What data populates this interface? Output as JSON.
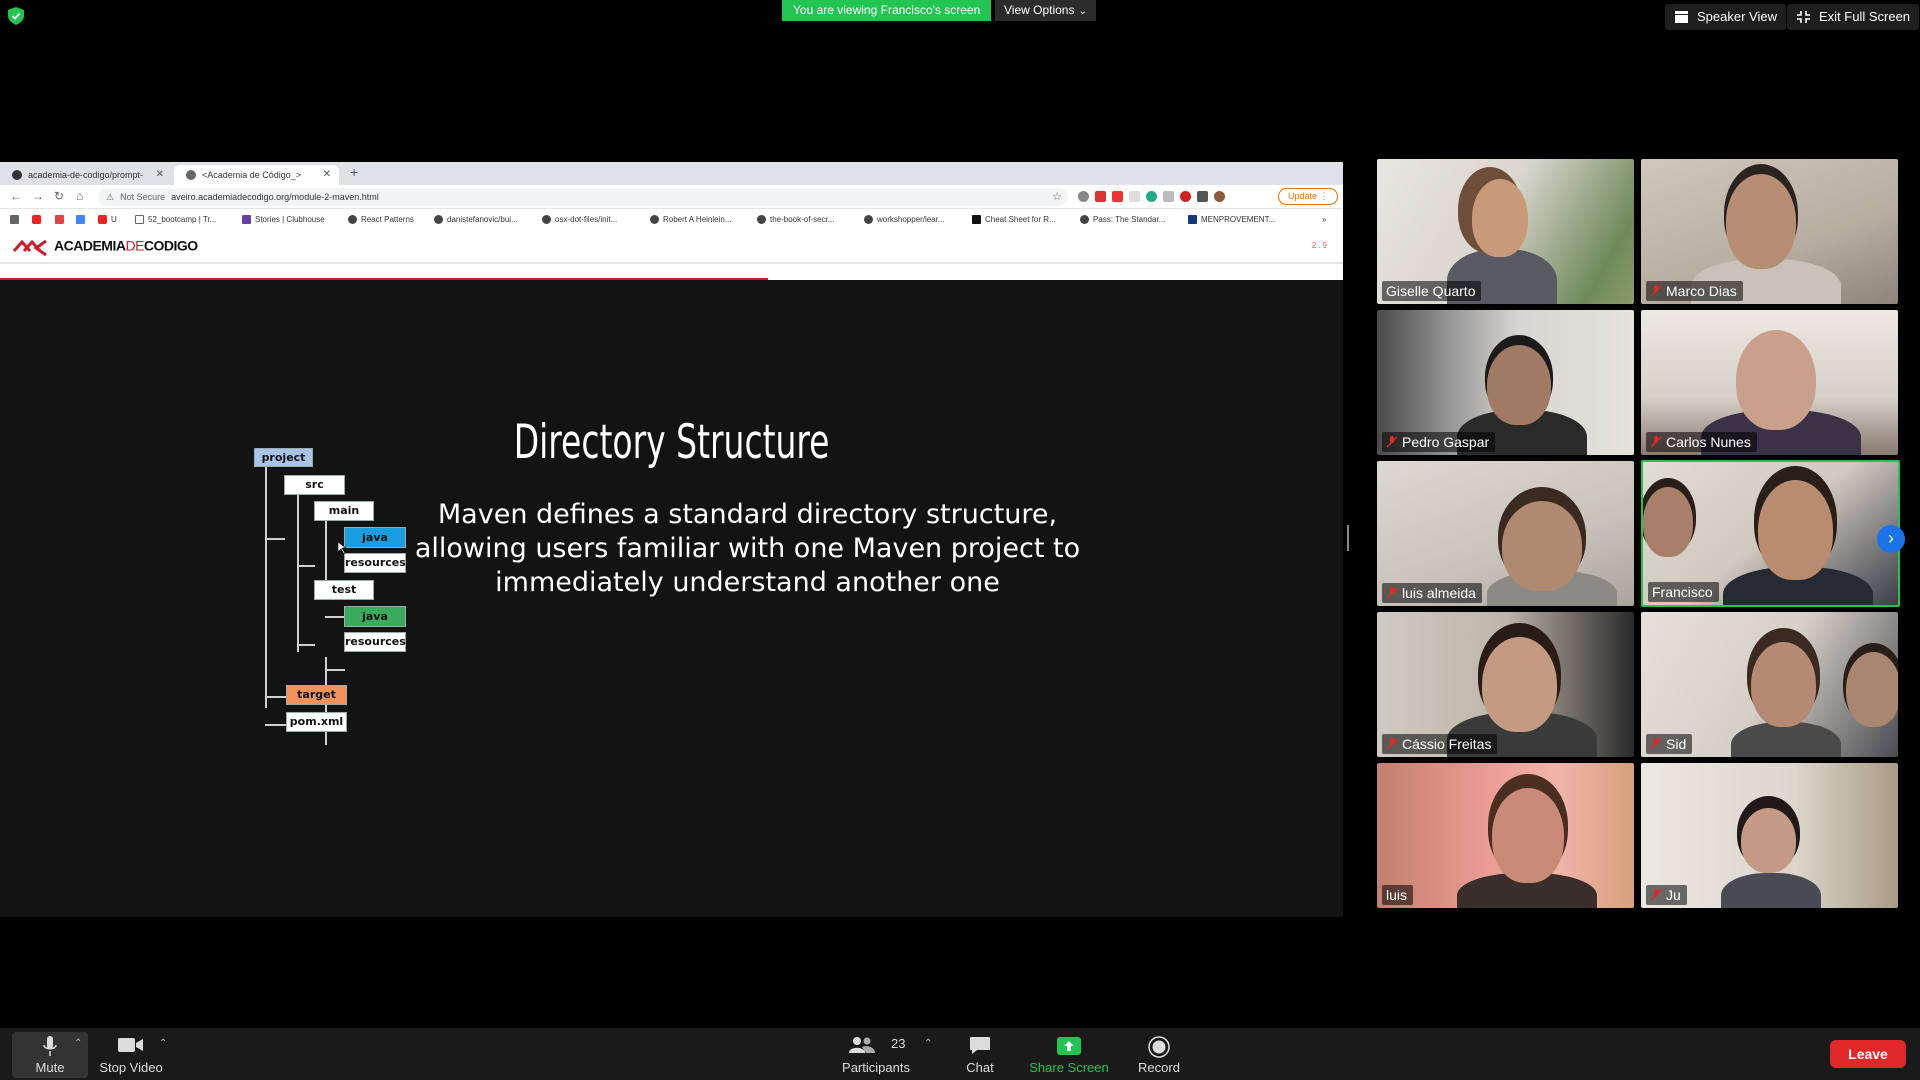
{
  "zoom": {
    "viewing_banner": "You are viewing Francisco's screen",
    "view_options": "View Options",
    "speaker_view": "Speaker View",
    "exit_full_screen": "Exit Full Screen",
    "participants_count": "23"
  },
  "browser": {
    "tabs": [
      {
        "label": "academia-de-codigo/prompt-",
        "active": false
      },
      {
        "label": "<Academia de Código_>",
        "active": true
      }
    ],
    "url_security": "Not Secure",
    "url": "aveiro.academiadecodigo.org/module-2-maven.html",
    "update_label": "Update",
    "bookmarks": [
      "U",
      "52_bootcamp | Tr...",
      "Stories | Clubhouse",
      "React Patterns",
      "danistefanovic/bui...",
      "osx-dot-files/init...",
      "Robert A Heinlein...",
      "the-book-of-secr...",
      "workshopper/lear...",
      "Cheat Sheet for R...",
      "Pass: The Standar...",
      "MENPROVEMENT..."
    ]
  },
  "site": {
    "logo_main": "ACADEMIA",
    "logo_de": "DE",
    "logo_end": "CODIGO",
    "slide_number": "2.9"
  },
  "slide": {
    "title": "Directory Structure",
    "body": "Maven defines a standard directory structure, allowing users familiar with one Maven project to immediately understand another one",
    "tree": {
      "project": "project",
      "src": "src",
      "main": "main",
      "main_java": "java",
      "main_resources": "resources",
      "test": "test",
      "test_java": "java",
      "test_resources": "resources",
      "target": "target",
      "pom": "pom.xml"
    }
  },
  "participants": [
    {
      "name": "Giselle Quarto",
      "muted": false
    },
    {
      "name": "Marco Dias",
      "muted": true
    },
    {
      "name": "Pedro Gaspar",
      "muted": true
    },
    {
      "name": "Carlos Nunes",
      "muted": true
    },
    {
      "name": "luis almeida",
      "muted": true
    },
    {
      "name": "Francisco",
      "muted": false,
      "active_speaker": true
    },
    {
      "name": "Cássio Freitas",
      "muted": true
    },
    {
      "name": "Sid",
      "muted": true
    },
    {
      "name": "luis",
      "muted": false
    },
    {
      "name": "Ju",
      "muted": true
    }
  ],
  "toolbar": {
    "mute": "Mute",
    "stop_video": "Stop Video",
    "participants": "Participants",
    "chat": "Chat",
    "share_screen": "Share Screen",
    "record": "Record",
    "leave": "Leave"
  },
  "colors": {
    "zoom_green": "#23c552",
    "leave_red": "#e02828",
    "brand_red": "#c81f2d",
    "java_main": "#1a9de0",
    "java_test": "#3aaa5c",
    "target": "#f0925a",
    "project": "#a9c4e8"
  }
}
